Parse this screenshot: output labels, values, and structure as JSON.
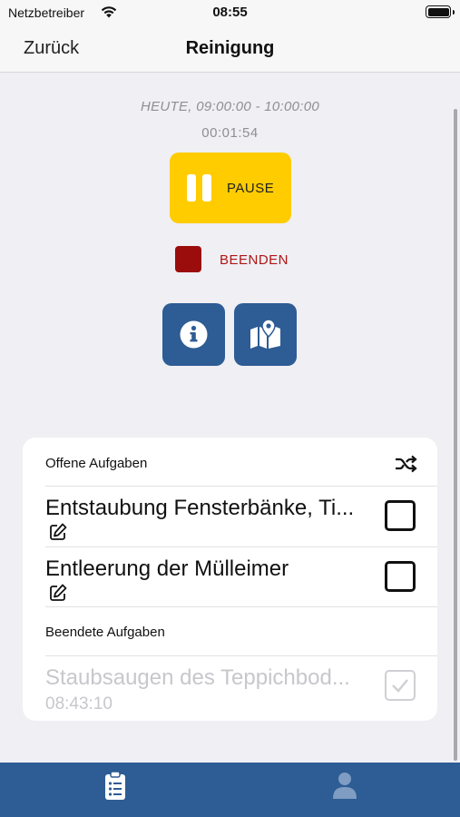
{
  "status_bar": {
    "carrier": "Netzbetreiber",
    "time": "08:55",
    "wifi_icon": "wifi-icon",
    "battery_icon": "battery-icon"
  },
  "nav": {
    "back_label": "Zurück",
    "title": "Reinigung"
  },
  "session": {
    "time_range": "HEUTE, 09:00:00 - 10:00:00",
    "elapsed": "00:01:54"
  },
  "controls": {
    "pause_label": "PAUSE",
    "stop_label": "BEENDEN",
    "info_icon": "info-icon",
    "map_icon": "map-marker-icon",
    "colors": {
      "pause": "#ffcc00",
      "stop": "#9b0c0c",
      "primary": "#2e5c94"
    }
  },
  "tasks": {
    "open_header": "Offene Aufgaben",
    "open": [
      {
        "title": "Entstaubung Fensterbänke, Ti...",
        "checked": false
      },
      {
        "title": "Entleerung der Mülleimer",
        "checked": false
      }
    ],
    "done_header": "Beendete Aufgaben",
    "done": [
      {
        "title": "Staubsaugen des Teppichbod...",
        "time": "08:43:10",
        "checked": true
      }
    ]
  },
  "tab_bar": {
    "tabs": [
      {
        "icon": "clipboard-icon",
        "selected": true
      },
      {
        "icon": "person-icon",
        "selected": false
      }
    ]
  }
}
